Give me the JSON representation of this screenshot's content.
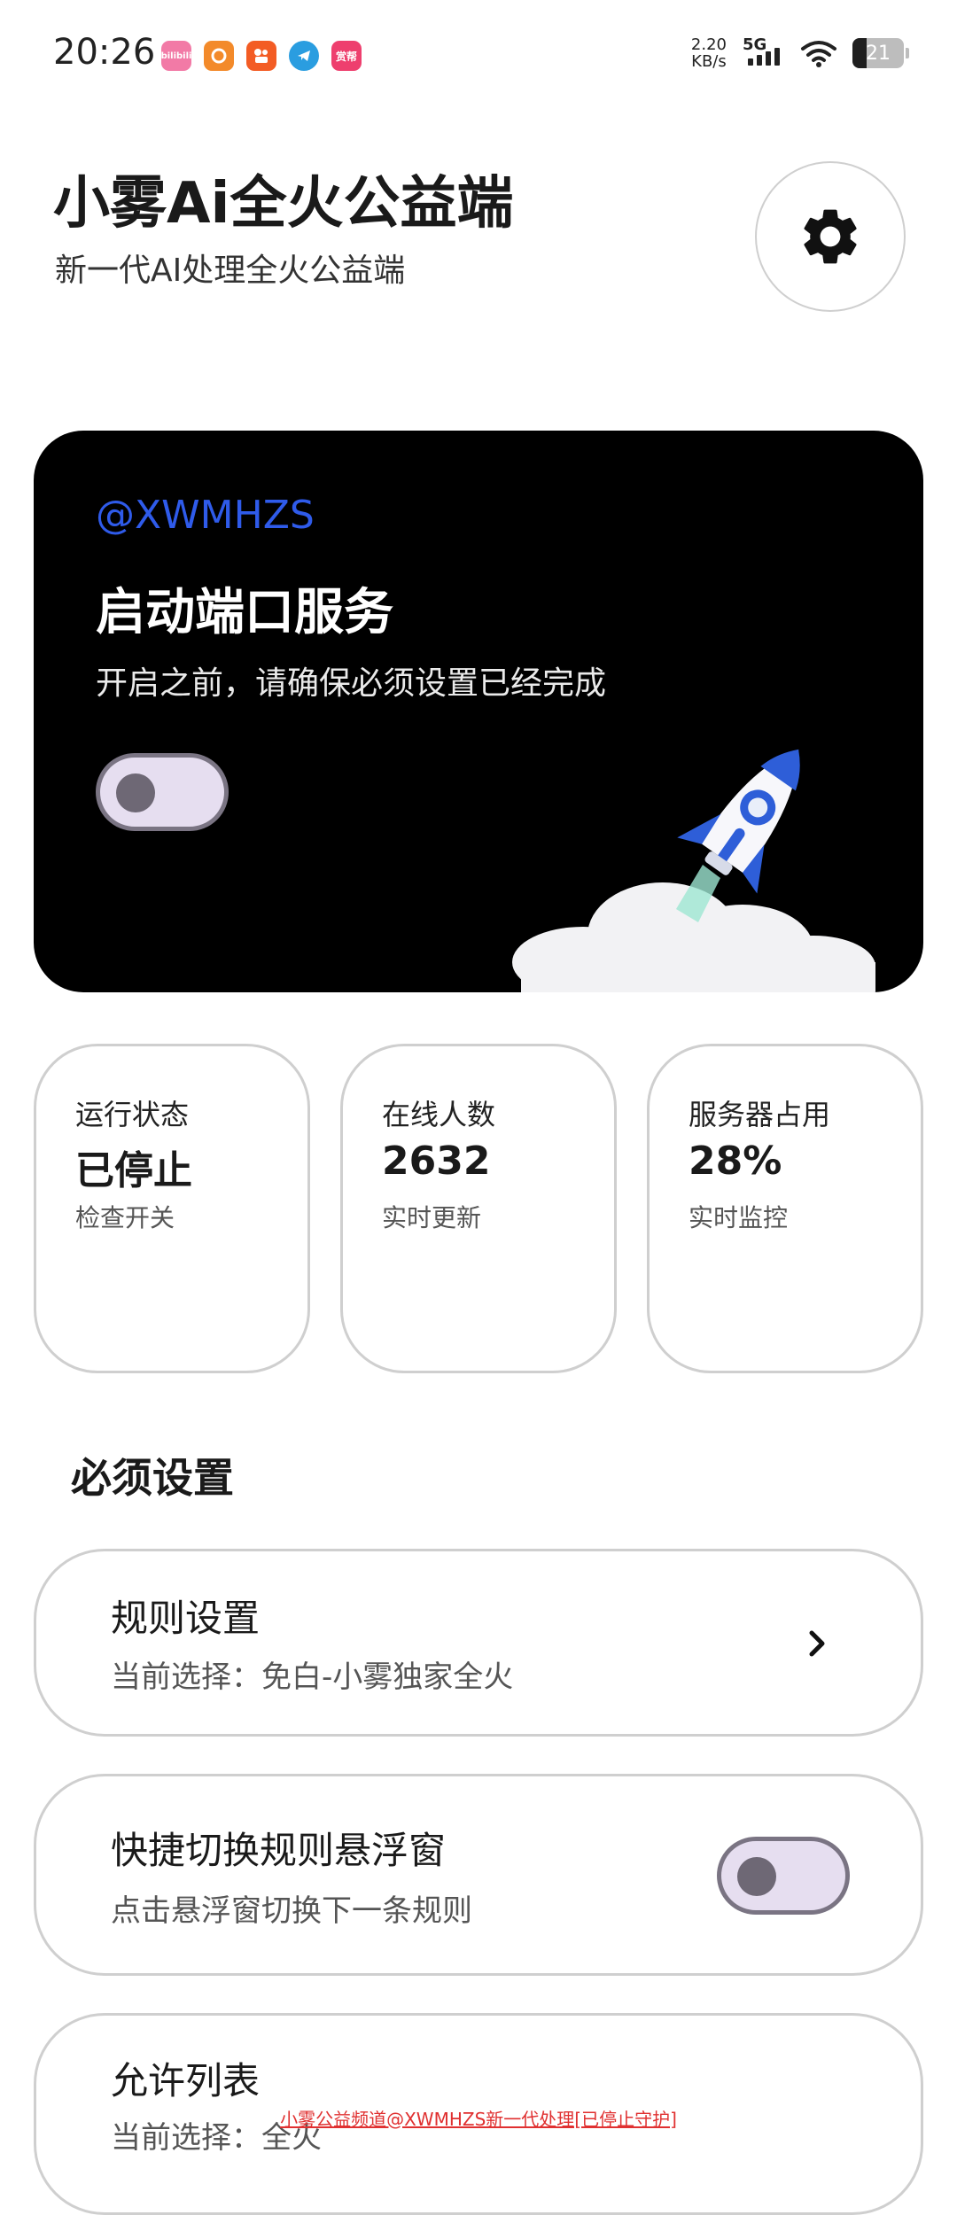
{
  "status_bar": {
    "time": "20:26",
    "network_speed_value": "2.20",
    "network_speed_unit": "KB/s",
    "signal_label": "5G",
    "battery_level": "21",
    "app_icons": [
      {
        "name": "bilibili-app-icon",
        "label": "bilibili",
        "color": "#f27aa6"
      },
      {
        "name": "orange-app-icon",
        "label": "",
        "color": "#f38a2a"
      },
      {
        "name": "kuaishou-app-icon",
        "label": "",
        "color": "#f35c24"
      },
      {
        "name": "telegram-app-icon",
        "label": "",
        "color": "#2a9de0"
      },
      {
        "name": "shangbang-app-icon",
        "label": "赏帮",
        "color": "#ee3f6e"
      }
    ]
  },
  "header": {
    "title": "小雾Ai全火公益端",
    "subtitle": "新一代AI处理全火公益端",
    "settings_icon": "gear-icon"
  },
  "hero": {
    "handle": "@XWMHZS",
    "title": "启动端口服务",
    "description": "开启之前，请确保必须设置已经完成",
    "toggle_on": false
  },
  "stats": [
    {
      "label": "运行状态",
      "value": "已停止",
      "note": "检查开关"
    },
    {
      "label": "在线人数",
      "value": "2632",
      "note": "实时更新"
    },
    {
      "label": "服务器占用",
      "value": "28%",
      "note": "实时监控"
    }
  ],
  "section": {
    "title": "必须设置"
  },
  "settings": {
    "rules": {
      "title": "规则设置",
      "desc": "当前选择：免白-小雾独家全火"
    },
    "float_window": {
      "title": "快捷切换规则悬浮窗",
      "desc": "点击悬浮窗切换下一条规则",
      "toggle_on": false
    },
    "allow_list": {
      "title": "允许列表",
      "desc": "当前选择：全火"
    }
  },
  "footer": {
    "text": "小雾公益频道@XWMHZS新一代处理[已停止守护]"
  },
  "colors": {
    "accent_blue": "#2f5bea",
    "toggle_track": "#e6def0",
    "toggle_border": "#7a7483",
    "card_border": "#cfcfcf"
  }
}
